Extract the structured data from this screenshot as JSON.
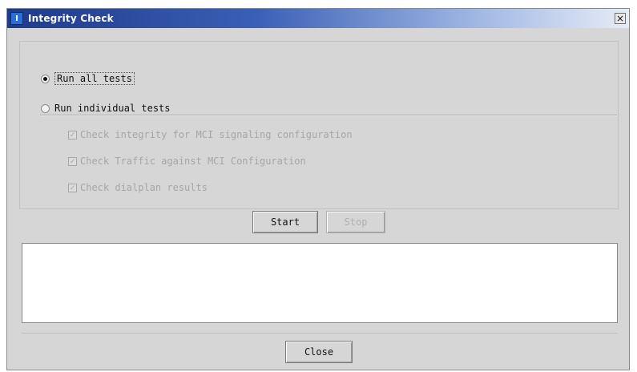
{
  "window": {
    "title": "Integrity Check",
    "icon": "app-icon",
    "icon_glyph": "I",
    "close_glyph": "×"
  },
  "options": {
    "run_all_label": "Run all tests",
    "run_all_selected": true,
    "run_individual_label": "Run individual tests",
    "run_individual_selected": false,
    "checks": [
      {
        "label": "Check integrity for MCI signaling configuration",
        "checked": true,
        "enabled": false
      },
      {
        "label": "Check Traffic against MCI Configuration",
        "checked": true,
        "enabled": false
      },
      {
        "label": "Check dialplan results",
        "checked": true,
        "enabled": false
      }
    ]
  },
  "buttons": {
    "start_label": "Start",
    "stop_label": "Stop",
    "close_label": "Close"
  },
  "output": {
    "text": ""
  },
  "colors": {
    "title_gradient_start": "#1f3a8a",
    "dialog_bg": "#d6d6d6",
    "disabled_text": "#a6a6a6"
  }
}
